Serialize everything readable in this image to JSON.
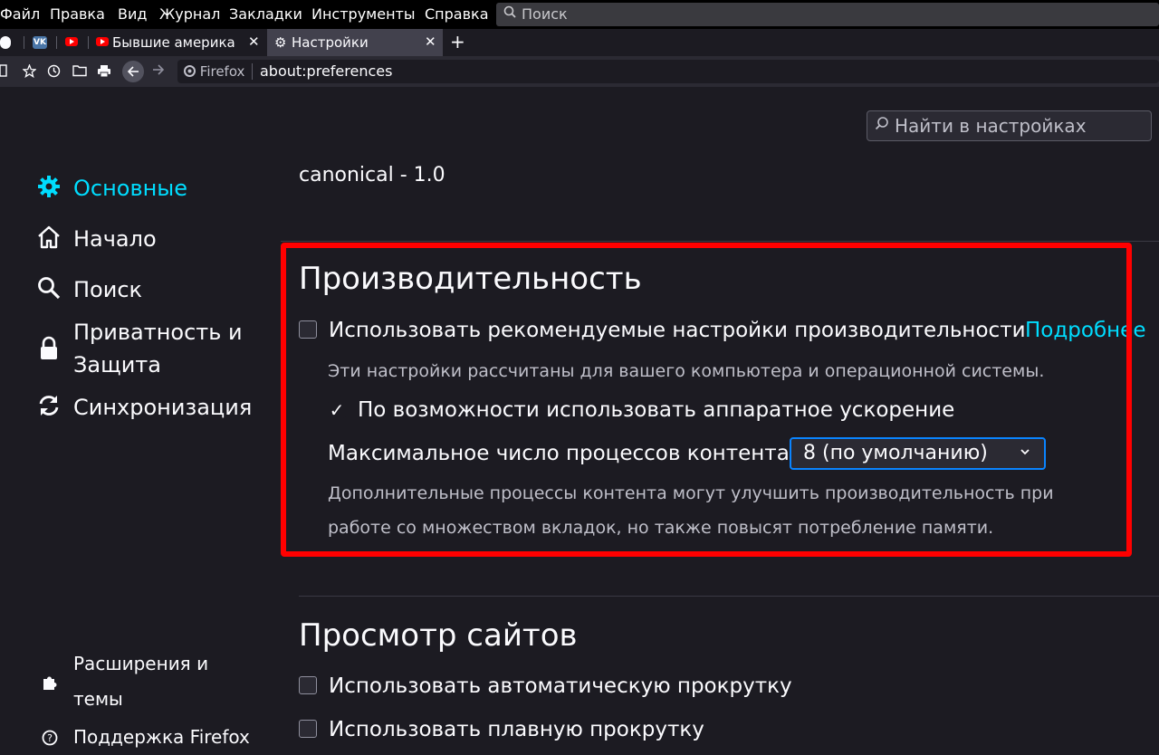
{
  "menubar": {
    "items": [
      "Файл",
      "Правка",
      "Вид",
      "Журнал",
      "Закладки",
      "Инструменты",
      "Справка"
    ],
    "search_placeholder": "Поиск"
  },
  "tabs": {
    "pinned": [
      {
        "icon": "pocket-icon"
      },
      {
        "icon": "vk-icon",
        "text": "VK"
      },
      {
        "icon": "youtube-icon"
      }
    ],
    "items": [
      {
        "label": "Бывшие америка",
        "icon": "youtube-icon",
        "active": false
      },
      {
        "label": "Настройки",
        "icon": "gear-icon",
        "active": true
      }
    ],
    "close_glyph": "✕",
    "new_tab_glyph": "+"
  },
  "navbar": {
    "identity_label": "Firefox",
    "url": "about:preferences"
  },
  "content": {
    "find_placeholder": "Найти в настройках",
    "cut_text": "canonical - 1.0",
    "sidebar": {
      "items": [
        {
          "label": "Основные",
          "icon": "gear-icon",
          "active": true
        },
        {
          "label": "Начало",
          "icon": "home-icon",
          "active": false
        },
        {
          "label": "Поиск",
          "icon": "search-icon",
          "active": false
        },
        {
          "label_line1": "Приватность и",
          "label_line2": "Защита",
          "icon": "lock-icon",
          "active": false
        },
        {
          "label": "Синхронизация",
          "icon": "sync-icon",
          "active": false
        }
      ],
      "bottom": [
        {
          "label_line1": "Расширения и",
          "label_line2": "темы",
          "icon": "puzzle-icon"
        },
        {
          "label": "Поддержка Firefox",
          "icon": "help-icon"
        }
      ]
    },
    "performance": {
      "title": "Производительность",
      "recommended_label": "Использовать рекомендуемые настройки производительности",
      "recommended_checked": false,
      "learn_more": "Подробнее",
      "recommended_desc": "Эти настройки рассчитаны для вашего компьютера и операционной системы.",
      "hw_accel_label": "По возможности использовать аппаратное ускорение",
      "hw_accel_checked": true,
      "process_label": "Максимальное число процессов контента",
      "process_value": "8 (по умолчанию)",
      "process_desc_line1": "Дополнительные процессы контента могут улучшить производительность при",
      "process_desc_line2": "работе со множеством вкладок, но также повысят потребление памяти."
    },
    "browsing": {
      "title": "Просмотр сайтов",
      "autoscroll_label": "Использовать автоматическую прокрутку",
      "autoscroll_checked": false,
      "smooth_label": "Использовать плавную прокрутку",
      "smooth_checked": false
    }
  },
  "colors": {
    "accent": "#00ddff",
    "highlight": "#ff0000",
    "focus": "#0a84ff",
    "background": "#1c1b22"
  }
}
